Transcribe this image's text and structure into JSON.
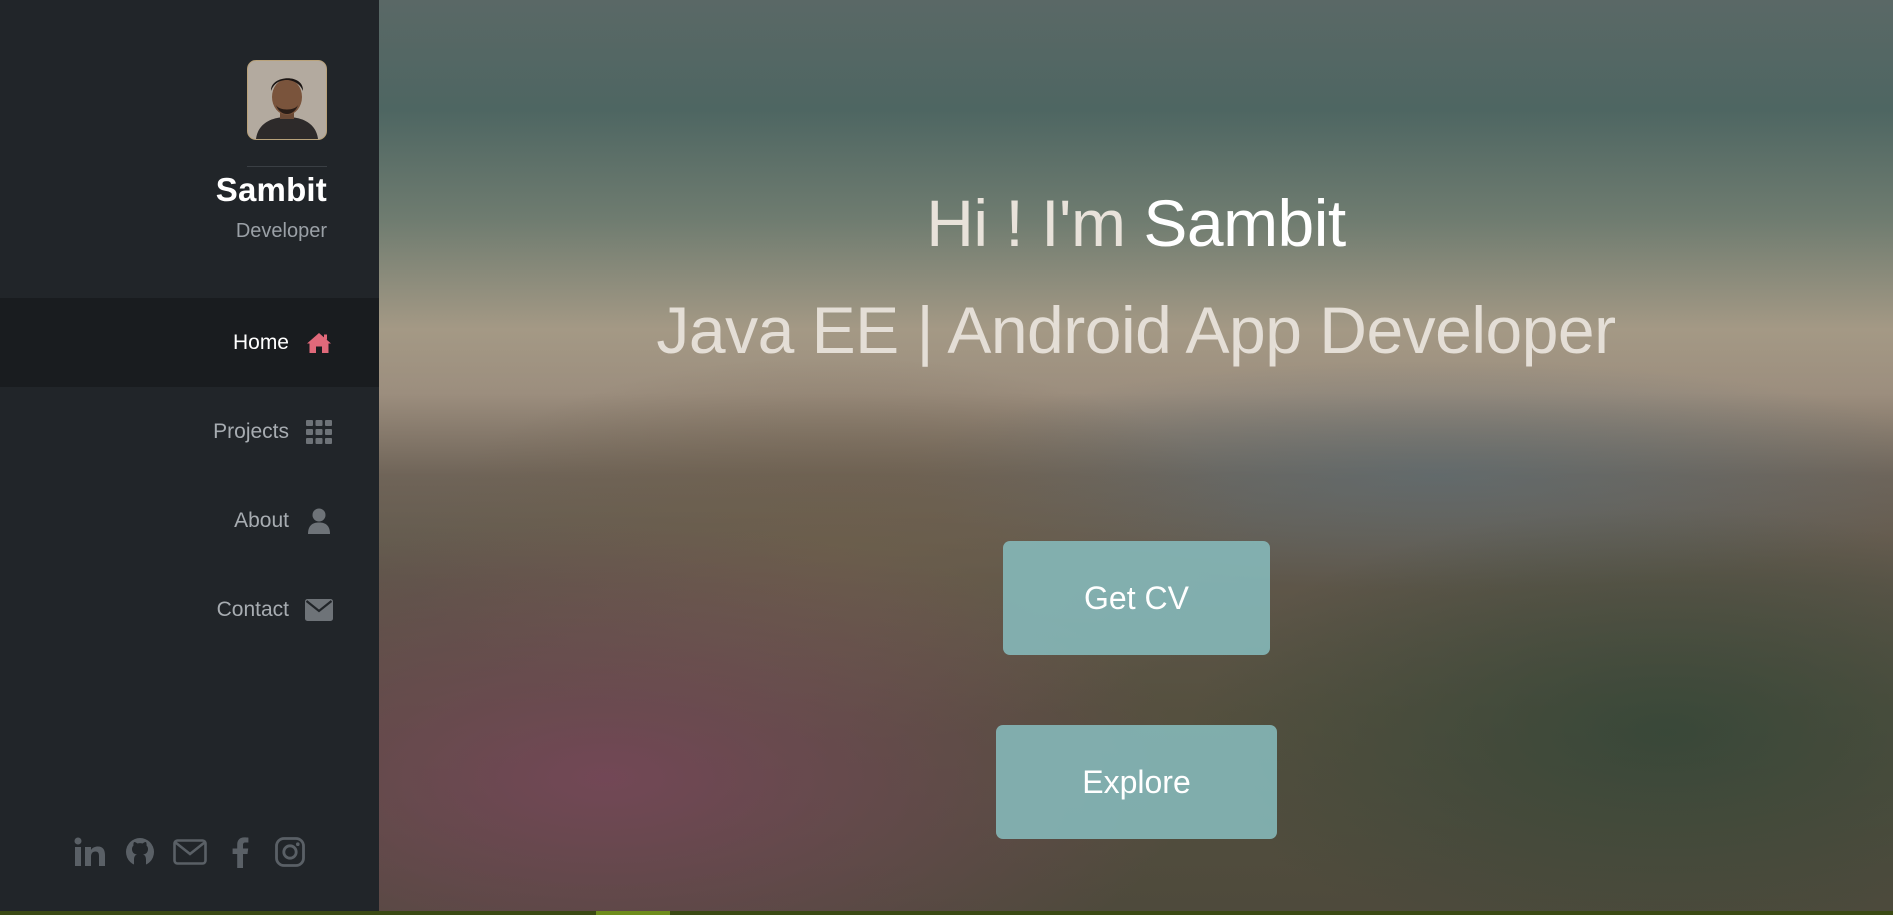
{
  "profile": {
    "name": "Sambit",
    "role": "Developer"
  },
  "nav": {
    "items": [
      {
        "label": "Home",
        "icon": "home-icon",
        "active": true
      },
      {
        "label": "Projects",
        "icon": "grid-icon",
        "active": false
      },
      {
        "label": "About",
        "icon": "user-icon",
        "active": false
      },
      {
        "label": "Contact",
        "icon": "envelope-icon",
        "active": false
      }
    ]
  },
  "social": [
    "linkedin-icon",
    "github-icon",
    "mail-icon",
    "facebook-icon",
    "instagram-icon"
  ],
  "hero": {
    "greeting": "Hi ! I'm",
    "name": "Sambit",
    "subtitle": "Java EE | Android App Developer",
    "cv_button": "Get CV",
    "explore_button": "Explore"
  },
  "colors": {
    "sidebar_bg": "#212529",
    "active_nav_bg": "#191c1f",
    "home_icon": "#e0697a",
    "button_bg": "#86bbbc"
  }
}
